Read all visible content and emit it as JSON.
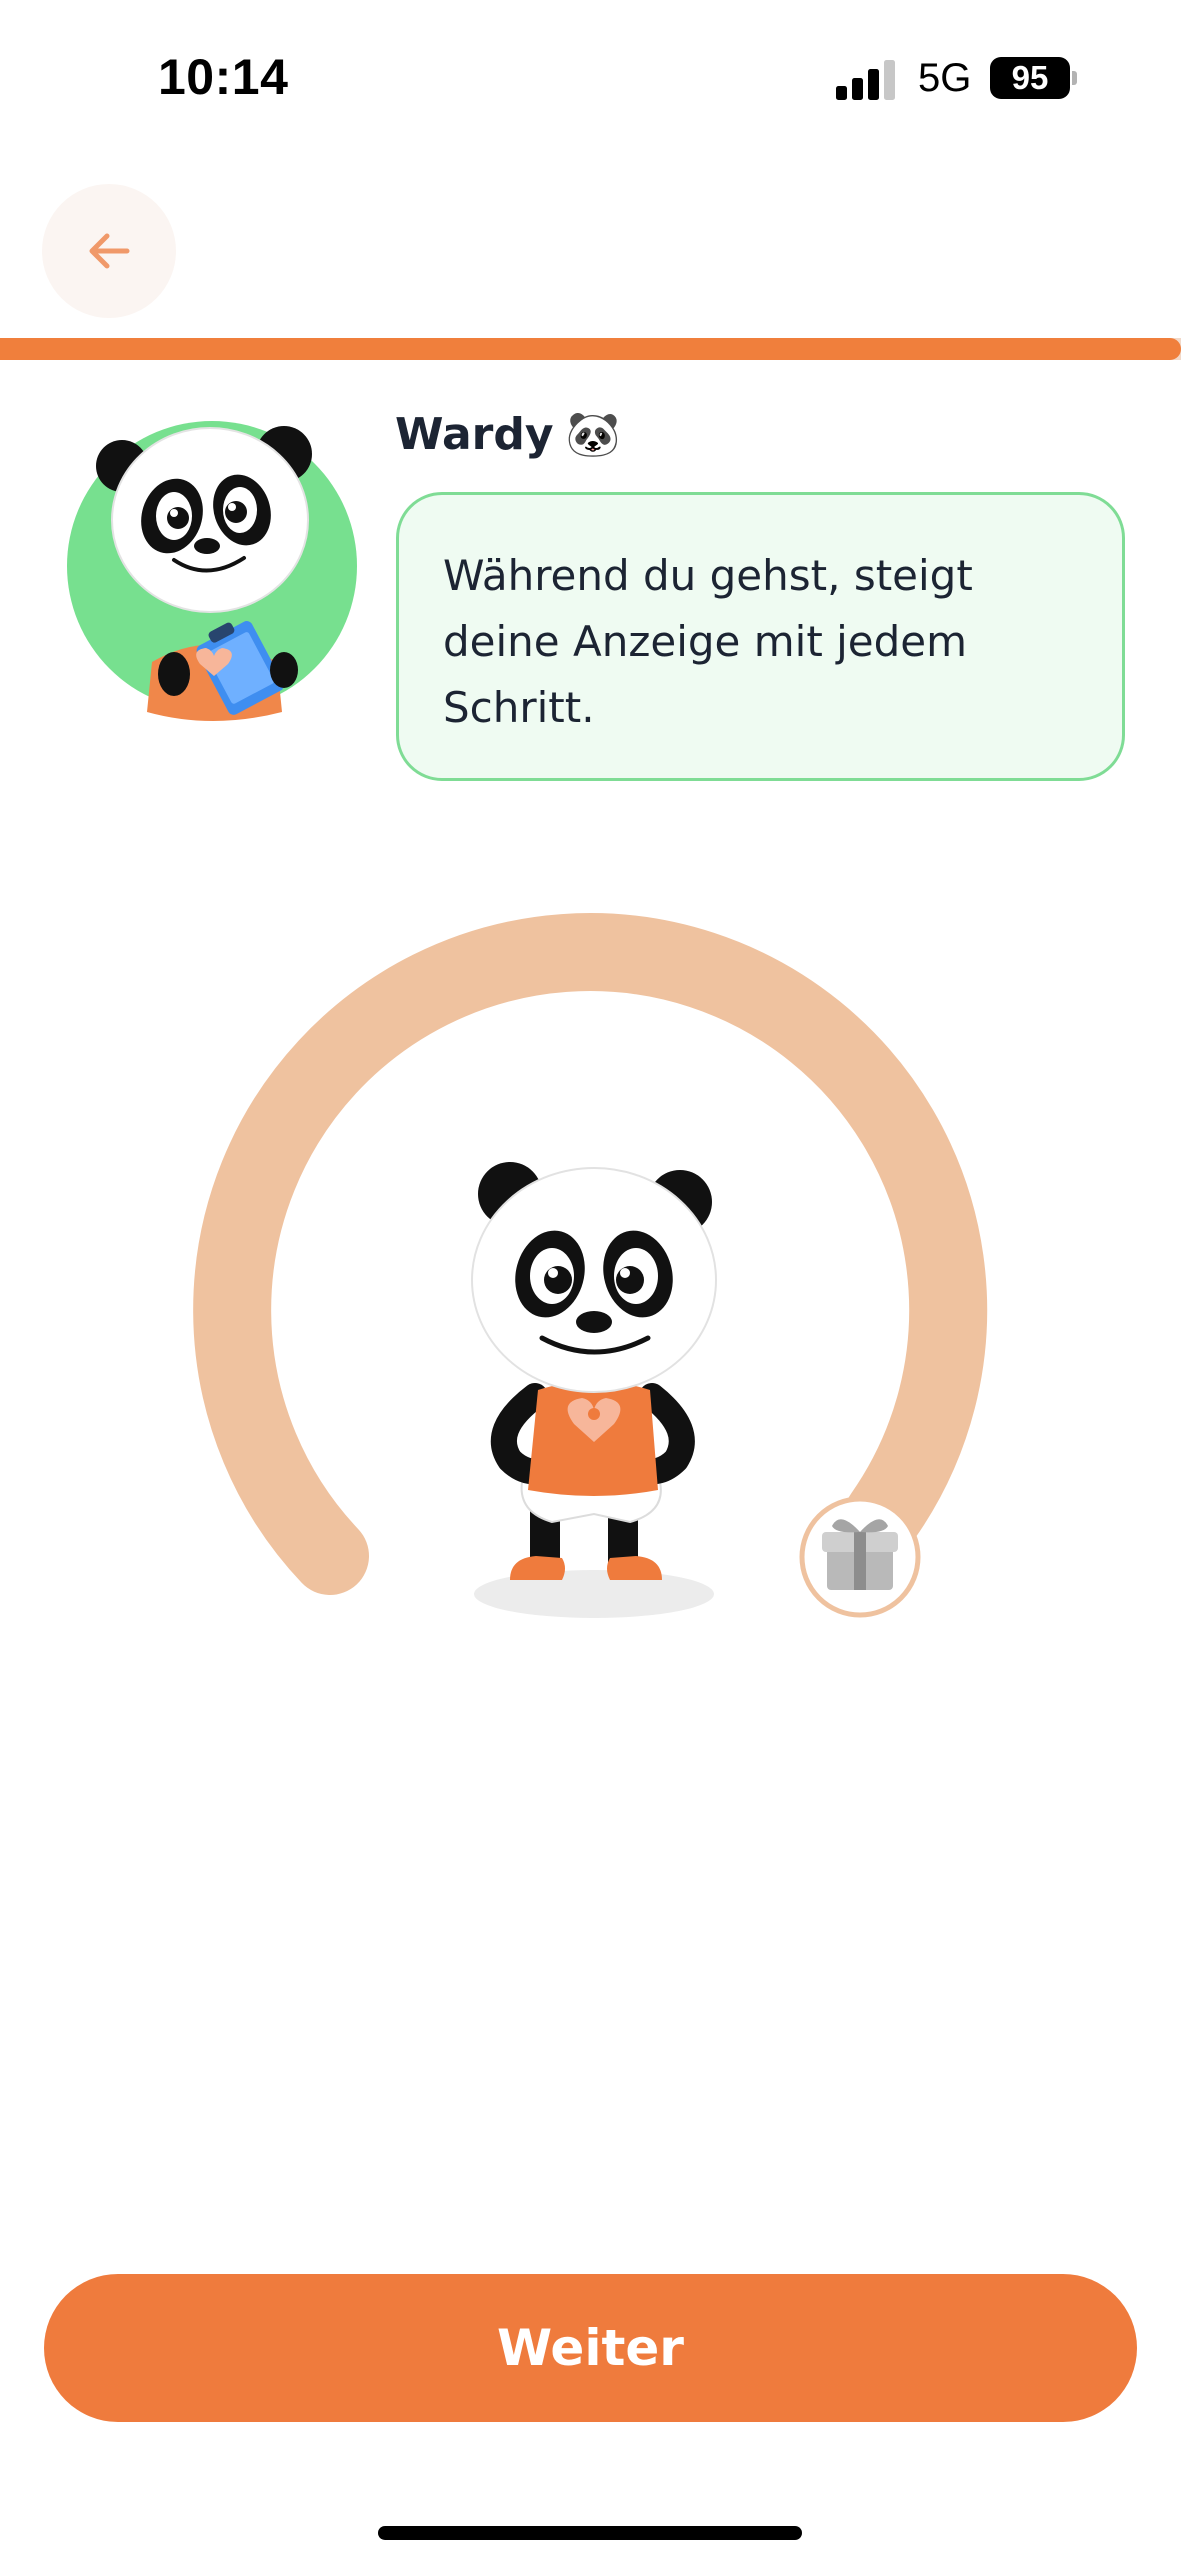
{
  "status_bar": {
    "time": "10:14",
    "network": "5G",
    "battery_level": "95",
    "signal_bars_active": 3,
    "signal_bars_total": 4
  },
  "navigation": {
    "back_icon": "arrow-left-icon"
  },
  "progress": {
    "fraction": 1.0,
    "color": "#f07f3c"
  },
  "message": {
    "sender_name": "Wardy",
    "sender_emoji": "🐼",
    "text": "Während du gehst, steigt deine Anzeige mit jedem Schritt."
  },
  "gauge": {
    "track_color": "#efc29f",
    "reward_icon": "gift-icon"
  },
  "actions": {
    "continue_label": "Weiter"
  },
  "colors": {
    "accent": "#ef7b3d",
    "bubble_background": "#effbf2",
    "bubble_border": "#7fdc95",
    "avatar_background": "#77e08f"
  }
}
